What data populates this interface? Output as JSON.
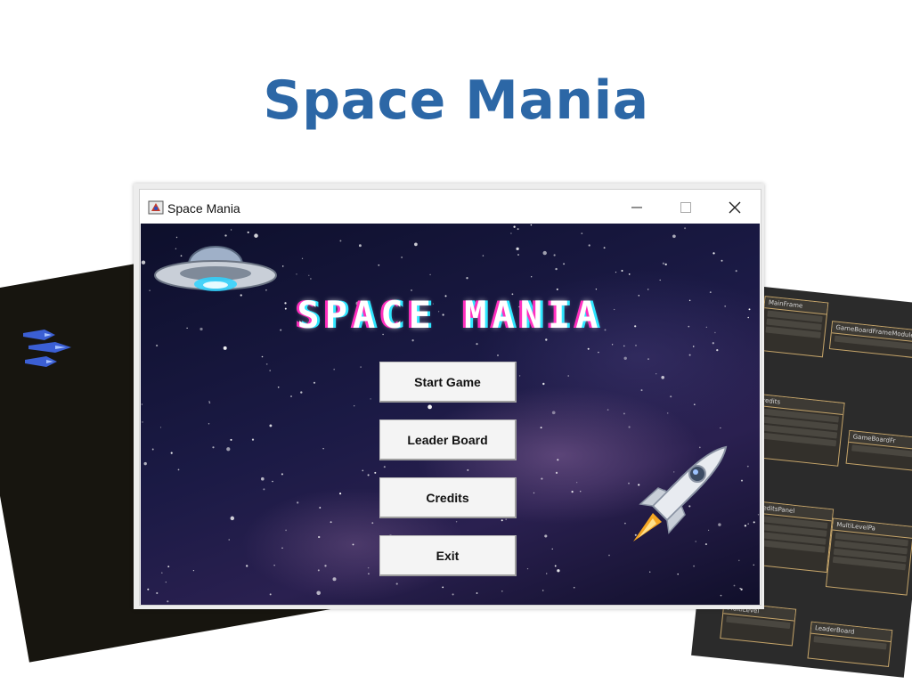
{
  "page": {
    "heading": "Space Mania"
  },
  "window": {
    "title": "Space Mania",
    "controls": {
      "minimize": "minimize-icon",
      "maximize": "maximize-icon",
      "close": "close-icon"
    }
  },
  "game": {
    "logo_text": "SPACE MANIA",
    "menu": {
      "start": "Start Game",
      "leaderboard": "Leader Board",
      "credits": "Credits",
      "exit": "Exit"
    }
  },
  "background_diagram": {
    "boxes": [
      "MainFrame",
      "GameBoardFrameModule",
      "Credits",
      "GameBoardFr",
      "CreditsPanel",
      "MultiLevelPa",
      "MultiLevel",
      "LeaderBoard"
    ]
  },
  "colors": {
    "heading": "#2c67a6",
    "logo_glow_left": "#ff2fbf",
    "logo_glow_right": "#2fe6ff"
  }
}
